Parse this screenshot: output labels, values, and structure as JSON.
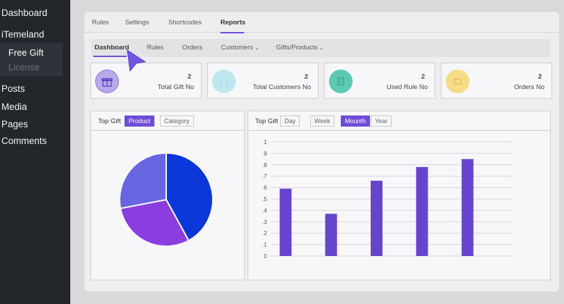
{
  "sidebar": {
    "items": [
      "Dashboard",
      "iTemeland",
      "Posts",
      "Media",
      "Pages",
      "Comments"
    ],
    "submenu": [
      "Free Gift",
      "License"
    ]
  },
  "top_tabs": [
    "Rules",
    "Settings",
    "Shortcodes",
    "Reports"
  ],
  "report_tabs": {
    "dashboard": "Dashboard",
    "rules": "Rules",
    "orders": "Orders",
    "customers": "Customers",
    "gifts_products": "Gifts/Products"
  },
  "stats": [
    {
      "value": "2",
      "label": "Total Gift No",
      "icon": "gift-icon",
      "color": "#b9a9ea"
    },
    {
      "value": "2",
      "label": "Total Customers No",
      "icon": "customers-icon",
      "color": "#bfe7ee"
    },
    {
      "value": "2",
      "label": "Used Rule No",
      "icon": "rule-icon",
      "color": "#5cc9b3"
    },
    {
      "value": "2",
      "label": "Orders No",
      "icon": "orders-icon",
      "color": "#f6dc86"
    }
  ],
  "pie_panel": {
    "title": "Top Gift",
    "toggles": [
      "Product",
      "Category"
    ],
    "active": "Product"
  },
  "bar_panel": {
    "title": "Top Gift",
    "toggles": [
      "Day",
      "Week",
      "Mounth",
      "Year"
    ],
    "active": "Mounth"
  },
  "chart_data": [
    {
      "type": "pie",
      "values": [
        0.42,
        0.3,
        0.28
      ],
      "colors": [
        "#0b37d8",
        "#8b3ee0",
        "#6766e0"
      ]
    },
    {
      "type": "bar",
      "y_ticks": [
        "0",
        ".1",
        ".2",
        ".3",
        ".4",
        ".5",
        ".6",
        ".7",
        ".8",
        ".9",
        "1"
      ],
      "ylim": [
        0,
        1
      ],
      "values": [
        0.59,
        0.37,
        0.66,
        0.78,
        0.85
      ],
      "color": "#6744cc",
      "grid": true
    }
  ]
}
